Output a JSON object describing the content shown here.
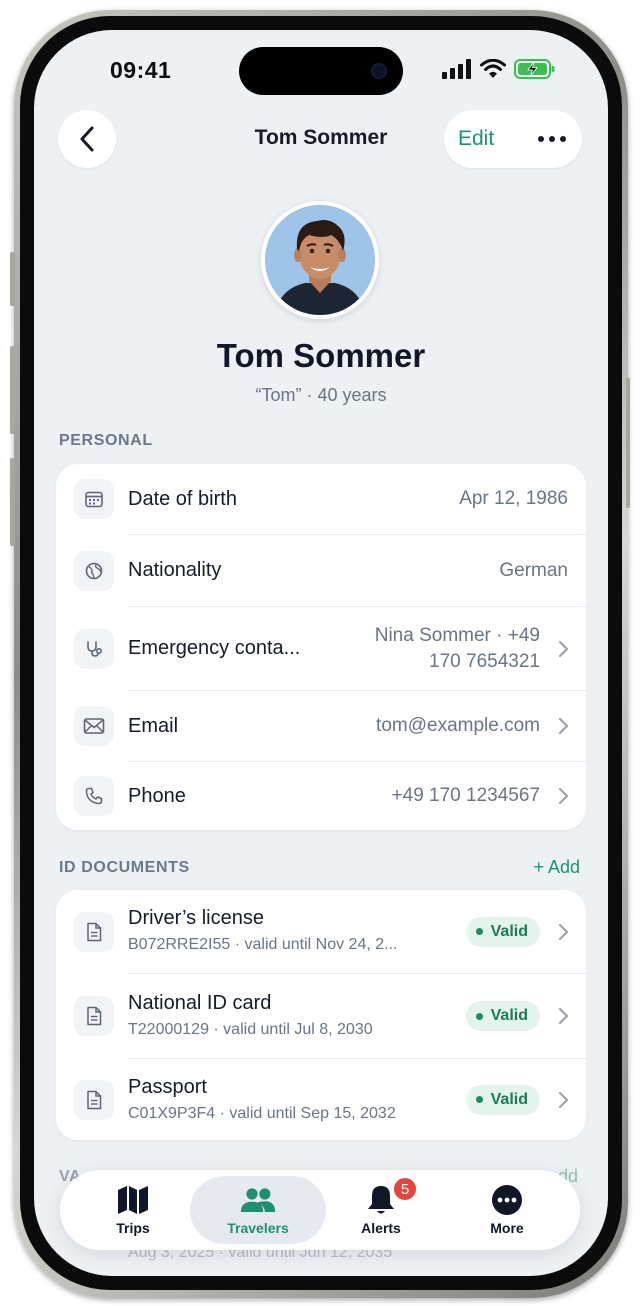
{
  "status_bar": {
    "time": "09:41"
  },
  "nav": {
    "title": "Tom Sommer",
    "edit_label": "Edit"
  },
  "profile": {
    "name": "Tom Sommer",
    "subtitle": "“Tom” · 40 years"
  },
  "personal": {
    "section_label": "PERSONAL",
    "rows": [
      {
        "label": "Date of birth",
        "value": "Apr 12, 1986",
        "icon": "calendar-icon"
      },
      {
        "label": "Nationality",
        "value": "German",
        "icon": "globe-icon"
      },
      {
        "label": "Emergency conta...",
        "value_line1": "Nina Sommer · +49",
        "value_line2": "170 7654321",
        "icon": "stethoscope-icon"
      },
      {
        "label": "Email",
        "value": "tom@example.com",
        "icon": "mail-icon"
      },
      {
        "label": "Phone",
        "value": "+49 170 1234567",
        "icon": "phone-icon"
      }
    ]
  },
  "id_documents": {
    "section_label": "ID DOCUMENTS",
    "add_label": "+ Add",
    "items": [
      {
        "title": "Driver’s license",
        "subtitle": "B072RRE2I55 · valid until Nov 24, 2...",
        "status": "Valid",
        "icon": "document-icon"
      },
      {
        "title": "National ID card",
        "subtitle": "T22000129 · valid until Jul 8, 2030",
        "status": "Valid",
        "icon": "document-icon"
      },
      {
        "title": "Passport",
        "subtitle": "C01X9P3F4 · valid until Sep 15, 2032",
        "status": "Valid",
        "icon": "document-icon"
      }
    ]
  },
  "next_section": {
    "partial_label": "VA",
    "partial_action": "dd",
    "partial_subtitle": "Aug 3, 2025 · valid until Jun 12, 2035"
  },
  "tabbar": {
    "tabs": [
      {
        "label": "Trips",
        "icon": "map-icon",
        "active": false
      },
      {
        "label": "Travelers",
        "icon": "people-icon",
        "active": true
      },
      {
        "label": "Alerts",
        "icon": "bell-icon",
        "active": false
      },
      {
        "label": "More",
        "icon": "more-icon",
        "active": false
      }
    ],
    "alerts_badge": "5"
  },
  "colors": {
    "accent": "#1f9077",
    "valid_bg": "#e4f4ec",
    "badge_red": "#e5453e",
    "screen_bg": "#eef1f4"
  }
}
